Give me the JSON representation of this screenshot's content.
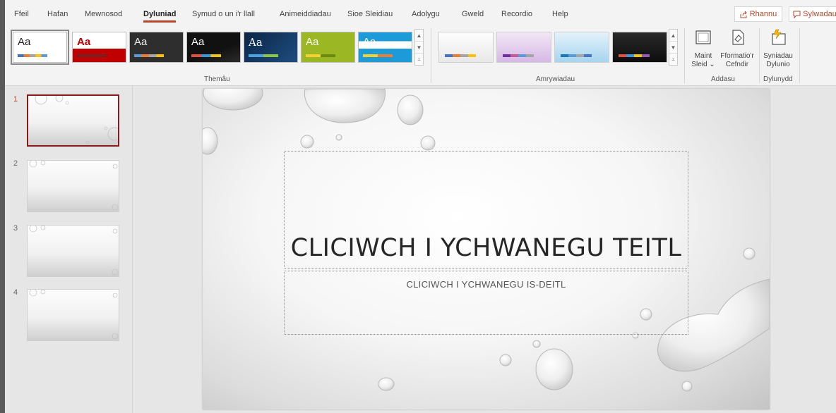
{
  "tabs": [
    "Ffeil",
    "Hafan",
    "Mewnosod",
    "Dyluniad",
    "Symud o un i'r llall",
    "Animeiddiadau",
    "Sioe Sleidiau",
    "Adolygu",
    "Gweld",
    "Recordio",
    "Help"
  ],
  "share_label": "Rhannu",
  "comments_label": "Sylwadau",
  "groups": {
    "themes": "Themâu",
    "variants": "Amrywiadau",
    "customize": "Addasu",
    "designer": "Dylunydd"
  },
  "theme_sample": "Aa",
  "commands": {
    "slide_size": [
      "Maint",
      "Sleid ⌄"
    ],
    "format_background": [
      "Fformatio'r",
      "Cefndir"
    ],
    "design_ideas": [
      "Syniadau",
      "Dylunio"
    ]
  },
  "thumbnails": [
    "1",
    "2",
    "3",
    "4"
  ],
  "slide": {
    "title": "CLICIWCH I YCHWANEGU TEITL",
    "subtitle": "CLICIWCH I YCHWANEGU IS-DEITL"
  },
  "colors": {
    "accent": "#b7472a",
    "selected_thumb": "#8b1a1a"
  }
}
